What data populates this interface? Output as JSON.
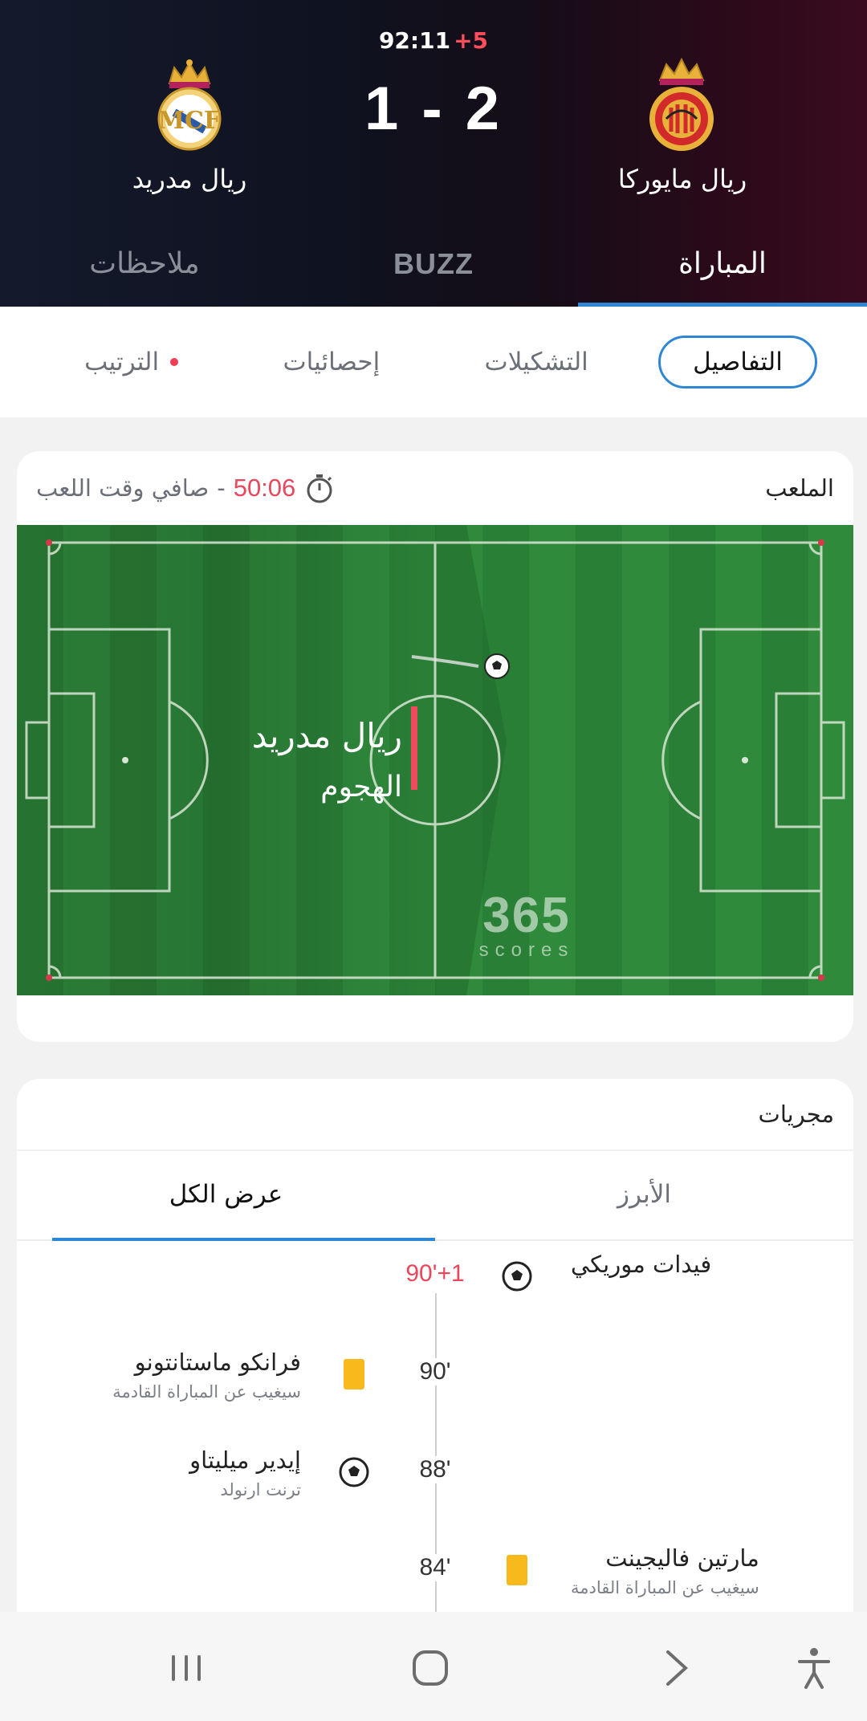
{
  "match": {
    "clock": "92:11",
    "added_time": "+5",
    "score": "1 - 2",
    "home_team": "ريال مايوركا",
    "away_team": "ريال مدريد"
  },
  "main_tabs": [
    {
      "label": "المباراة",
      "active": true
    },
    {
      "label": "BUZZ",
      "active": false
    },
    {
      "label": "ملاحظات",
      "active": false
    }
  ],
  "sub_tabs": [
    {
      "label": "التفاصيل",
      "active": true
    },
    {
      "label": "التشكيلات",
      "active": false
    },
    {
      "label": "إحصائيات",
      "active": false
    },
    {
      "label": "الترتيب",
      "active": false
    }
  ],
  "pitch_card": {
    "title": "الملعب",
    "net_time_label": "صافي وقت اللعب",
    "net_time_value": "50:06",
    "attacking_team": "ريال مدريد",
    "attack_state": "الهجوم",
    "watermark_number": "365",
    "watermark_text": "scores"
  },
  "events_card": {
    "title": "مجريات",
    "tabs": [
      {
        "label": "الأبرز",
        "active": false
      },
      {
        "label": "عرض الكل",
        "active": true
      }
    ],
    "events": [
      {
        "minute": "90'+1",
        "side": "right",
        "type": "goal",
        "name": "فيدات موريكي",
        "sub": ""
      },
      {
        "minute": "90'",
        "side": "left",
        "type": "yellow-card",
        "name": "فرانكو ماستانتونو",
        "sub": "سيغيب عن المباراة القادمة"
      },
      {
        "minute": "88'",
        "side": "left",
        "type": "goal",
        "name": "إيدير ميليتاو",
        "sub": "ترنت ارنولد"
      },
      {
        "minute": "84'",
        "side": "right",
        "type": "yellow-card",
        "name": "مارتين فاليجينت",
        "sub": "سيغيب عن المباراة القادمة"
      }
    ]
  },
  "colors": {
    "accent_blue": "#2f86d4",
    "live_red": "#e8475c",
    "yellow_card": "#f7b91c",
    "pitch_green": "#2e8a3c"
  },
  "navbar": {
    "icons": [
      "recent-apps-icon",
      "home-icon",
      "back-icon",
      "accessibility-icon"
    ]
  }
}
